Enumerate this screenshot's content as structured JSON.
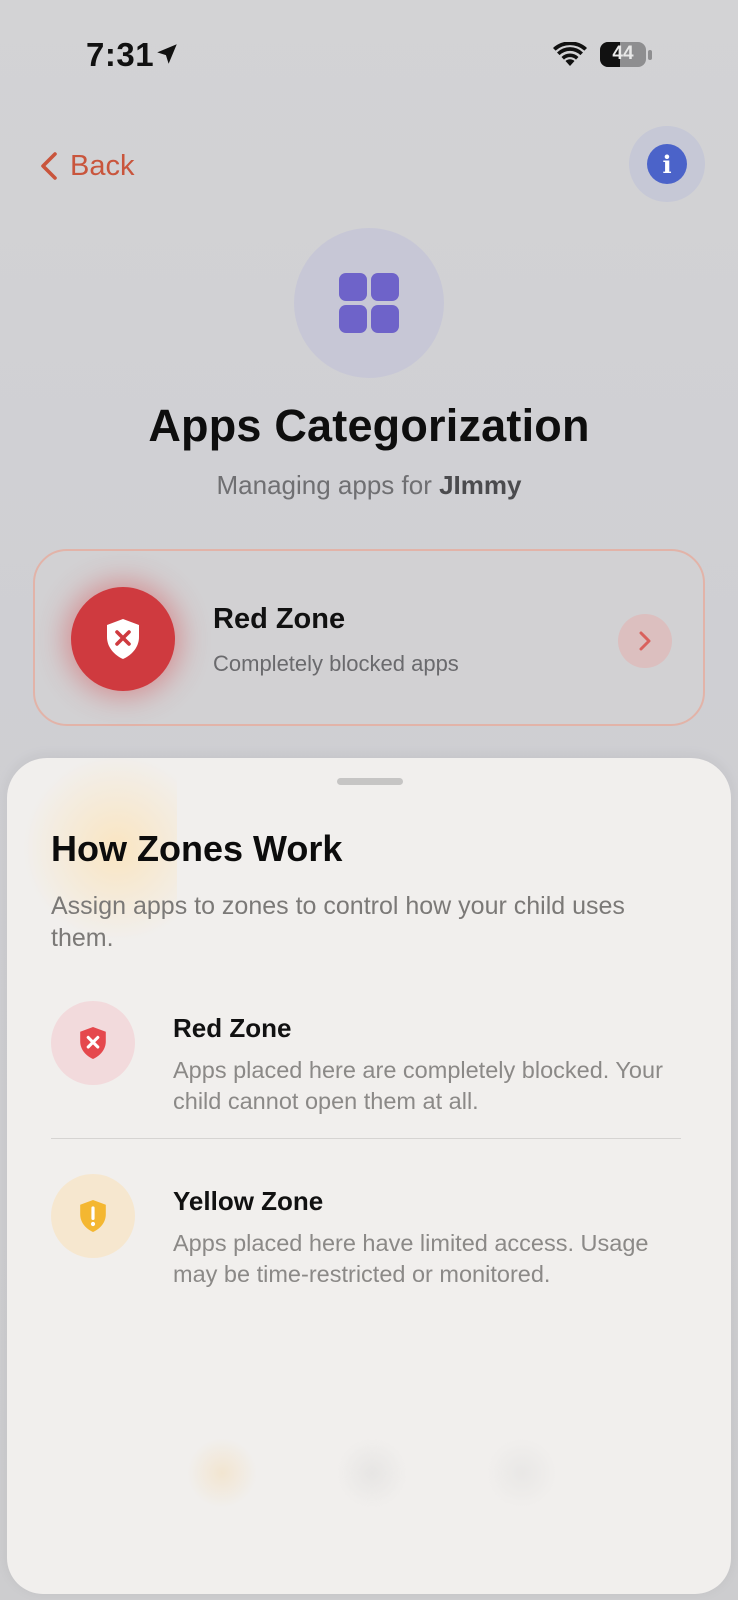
{
  "status_bar": {
    "time": "7:31",
    "battery_level": "44",
    "icons": [
      "location-arrow-icon",
      "wifi-icon",
      "battery-icon"
    ]
  },
  "nav": {
    "back_label": "Back",
    "info_icon": "info-icon"
  },
  "header": {
    "icon": "grid-apps-icon",
    "title": "Apps Categorization",
    "subtitle_prefix": "Managing apps for ",
    "child_name": "JImmy"
  },
  "zone_card": {
    "title": "Red Zone",
    "description": "Completely blocked apps",
    "icon": "shield-x-icon",
    "arrow_icon": "chevron-right-icon"
  },
  "sheet": {
    "title": "How Zones Work",
    "intro": "Assign apps to zones to control how your child uses them.",
    "items": [
      {
        "title": "Red Zone",
        "description": "Apps placed here are completely blocked. Your child cannot open them at all.",
        "icon": "shield-x-icon",
        "color": "#e5484d"
      },
      {
        "title": "Yellow Zone",
        "description": "Apps placed here have limited access. Usage may be time-restricted or monitored.",
        "icon": "shield-exclamation-icon",
        "color": "#f4b731"
      }
    ]
  },
  "colors": {
    "accent_back": "#c9553c",
    "info_blue": "#4b63c9",
    "grid_purple": "#6e63c9",
    "red_zone": "#cf3a3f"
  }
}
